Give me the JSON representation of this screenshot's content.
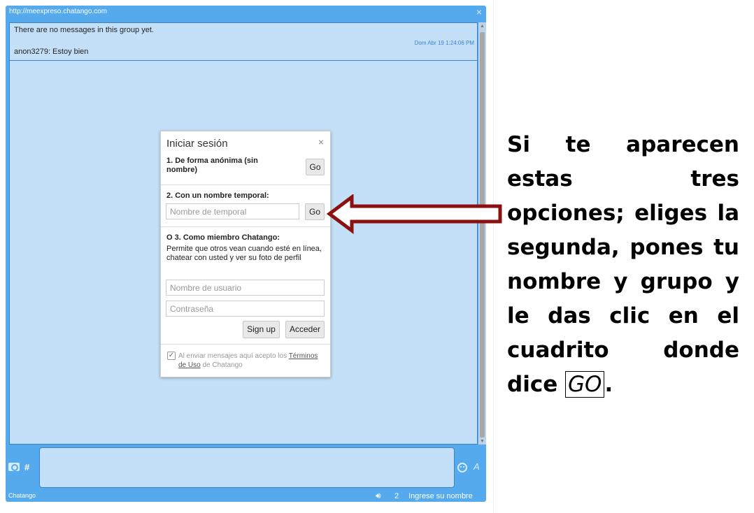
{
  "window": {
    "url": "http://meexpreso.chatango.com",
    "close_glyph": "×"
  },
  "messages": {
    "empty_notice": "There are no messages in this group yet.",
    "timestamp": "Dom Abr 19 1:24:06 PM",
    "message_text": "anon3279: Estoy bien"
  },
  "input_bar": {
    "hash": "#",
    "font_glyph": "A",
    "brand": "Chatango",
    "user_count": "2",
    "name_prompt": "Ingrese su nombre"
  },
  "login_dialog": {
    "title": "Iniciar sesión",
    "close_glyph": "×",
    "option1_label": "1. De forma anónima (sin nombre)",
    "go_label": "Go",
    "option2_label": "2. Con un nombre temporal:",
    "temp_name_placeholder": "Nombre de temporal",
    "option3_label": "O 3. Como miembro Chatango:",
    "option3_desc": "Permite que otros vean cuando esté en línea, chatear con usted y ver su foto de perfil",
    "username_placeholder": "Nombre de usuario",
    "password_placeholder": "Contraseña",
    "signup_label": "Sign up",
    "login_label": "Acceder",
    "check_glyph": "✓",
    "terms_prefix": "Al enviar mensajes aquí acepto los",
    "terms_link": "Términos de Uso",
    "terms_suffix": "de Chatango"
  },
  "instruction": {
    "text": "Si te aparecen estas tres opciones; eliges la segunda, pones tu nombre y grupo y le das clic en el cuadrito donde dice",
    "boxed": "GO",
    "end": "."
  },
  "colors": {
    "widget_blue": "#55aaee",
    "message_bg": "#c4e0f8",
    "arrow_red": "#8b1010"
  }
}
